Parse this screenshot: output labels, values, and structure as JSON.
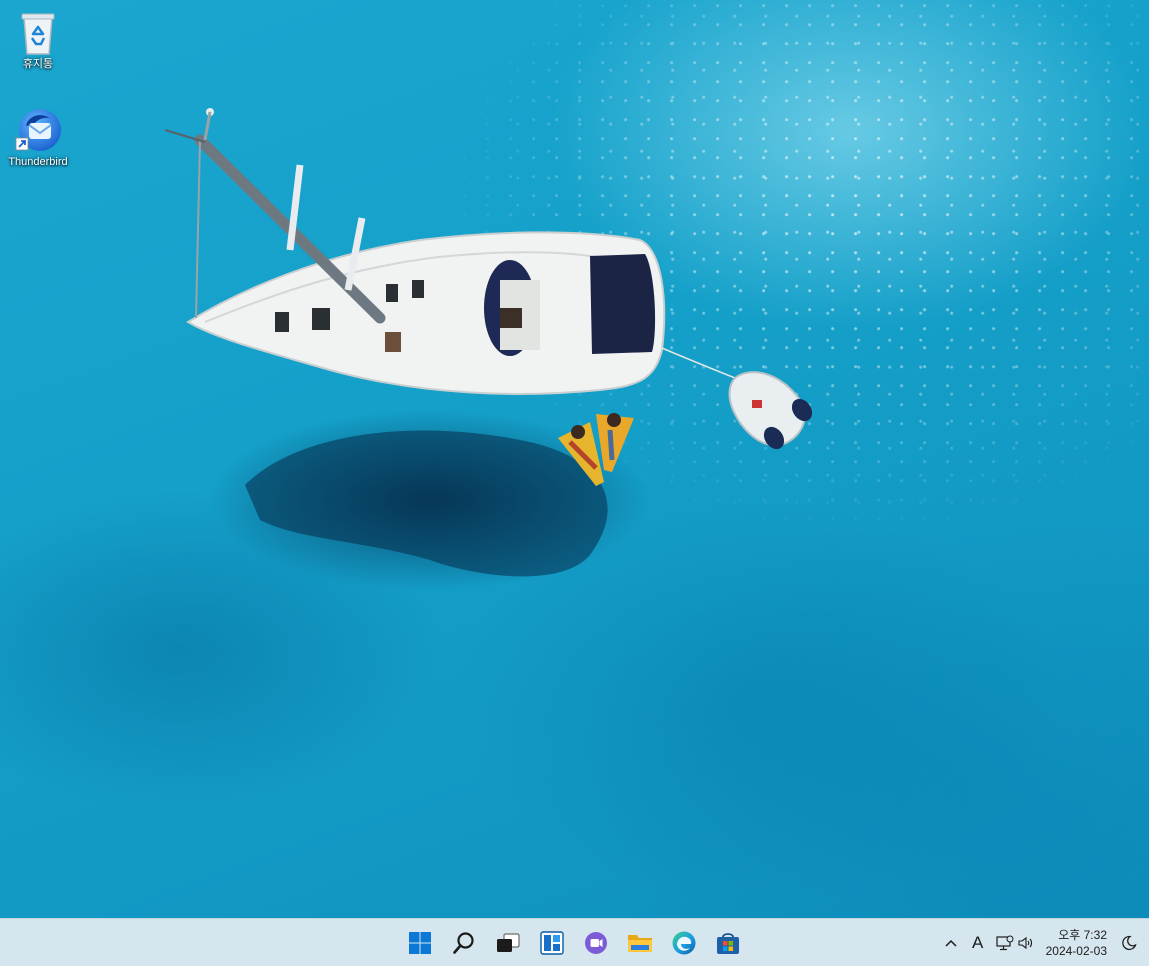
{
  "desktop": {
    "icons": [
      {
        "label": "휴지통",
        "icon": "recycle-bin-icon"
      },
      {
        "label": "Thunderbird",
        "icon": "thunderbird-icon"
      }
    ]
  },
  "taskbar": {
    "pinned": [
      {
        "name": "start",
        "icon": "windows-start-icon"
      },
      {
        "name": "search",
        "icon": "search-icon"
      },
      {
        "name": "task-view",
        "icon": "task-view-icon"
      },
      {
        "name": "widgets",
        "icon": "widgets-icon"
      },
      {
        "name": "chat",
        "icon": "teams-chat-icon"
      },
      {
        "name": "file-explorer",
        "icon": "folder-icon"
      },
      {
        "name": "edge",
        "icon": "edge-browser-icon"
      },
      {
        "name": "store",
        "icon": "microsoft-store-icon"
      }
    ],
    "tray": {
      "ime_label": "A",
      "time": "오후 7:32",
      "date": "2024-02-03"
    }
  },
  "colors": {
    "taskbar_bg": "#d6e6ee",
    "windows_blue": "#0a78d4",
    "water": "#14a0c9"
  }
}
